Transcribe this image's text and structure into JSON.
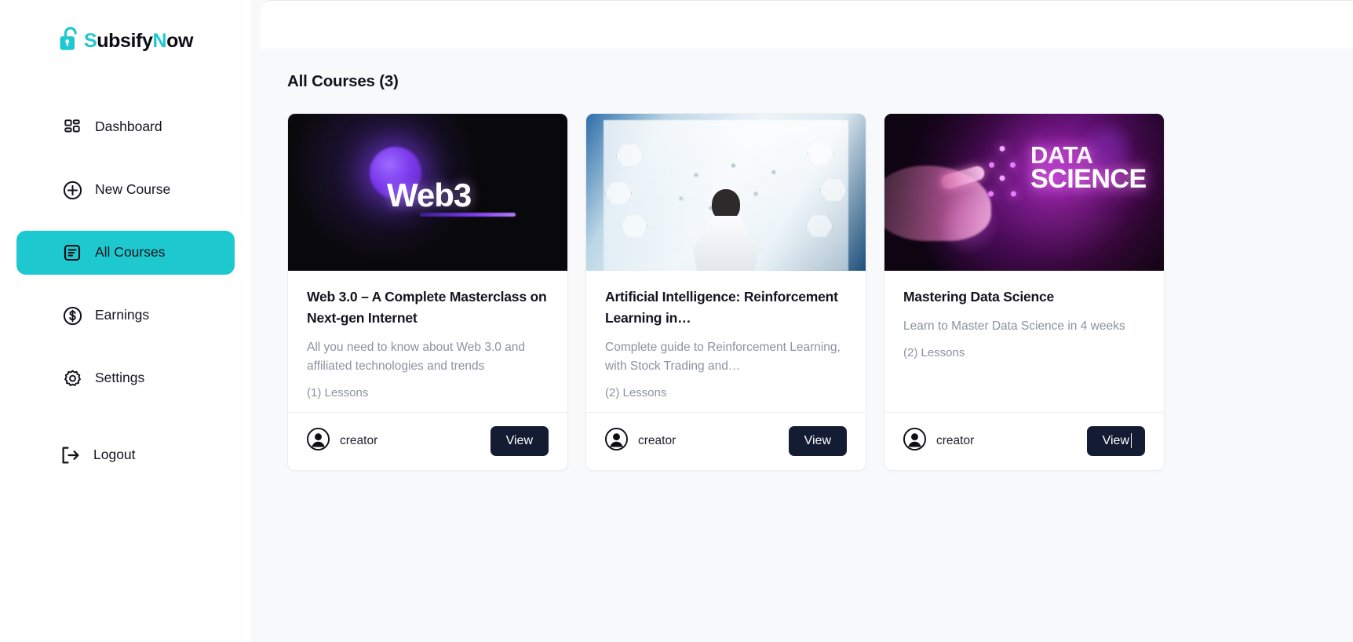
{
  "brand": {
    "name_part1": "S",
    "name_part2": "ubsify",
    "name_part3": "N",
    "name_part4": "ow",
    "accent_color": "#1ec8cf",
    "logo_icon": "open-padlock-icon"
  },
  "sidebar": {
    "items": [
      {
        "label": "Dashboard",
        "icon": "grid-icon",
        "active": false
      },
      {
        "label": "New Course",
        "icon": "plus-circle-icon",
        "active": false
      },
      {
        "label": "All Courses",
        "icon": "list-document-icon",
        "active": true
      },
      {
        "label": "Earnings",
        "icon": "dollar-circle-icon",
        "active": false
      },
      {
        "label": "Settings",
        "icon": "gear-icon",
        "active": false
      },
      {
        "label": "Logout",
        "icon": "logout-arrow-icon",
        "active": false
      }
    ]
  },
  "topbar": {
    "content": ""
  },
  "main": {
    "page_title": "All Courses (3)",
    "course_count": 3,
    "courses": [
      {
        "title": "Web 3.0 – A Complete Masterclass on Next-gen Internet",
        "description": "All you need to know about Web 3.0 and affiliated technologies and trends",
        "lessons_label": "(1) Lessons",
        "lessons_count": 1,
        "creator": "creator",
        "view_label": "View",
        "thumbnail": "web3-dark-purple-sphere-thumbnail",
        "thumb_text": "Web3",
        "focused": false
      },
      {
        "title": "Artificial Intelligence: Reinforcement Learning in…",
        "description": "Complete guide to Reinforcement Learning, with Stock Trading and…",
        "lessons_label": "(2) Lessons",
        "lessons_count": 2,
        "creator": "creator",
        "view_label": "View",
        "thumbnail": "ai-person-hologram-thumbnail",
        "thumb_text": "",
        "focused": false
      },
      {
        "title": "Mastering Data Science",
        "description": "Learn to Master Data Science in 4 weeks",
        "lessons_label": "(2) Lessons",
        "lessons_count": 2,
        "creator": "creator",
        "view_label": "View",
        "thumbnail": "data-science-neon-hand-thumbnail",
        "thumb_line1": "DATA",
        "thumb_line2": "SCIENCE",
        "focused": true
      }
    ]
  },
  "colors": {
    "accent_teal": "#1ec8cf",
    "button_dark": "#131c33",
    "page_bg": "#f7f9fb",
    "card_bg": "#ffffff",
    "muted_text": "#8b929e",
    "title_text": "#14141f"
  }
}
